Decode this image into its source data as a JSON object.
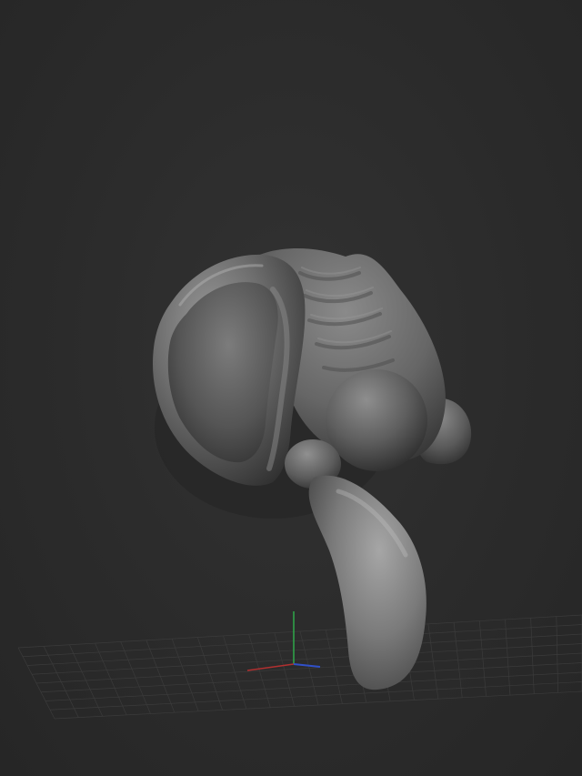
{
  "viewport": {
    "background": "#2b2b2b",
    "floor_grid_visible": true,
    "axis_gizmo": {
      "x_axis_color": "#b03030",
      "y_axis_color": "#2fa84a",
      "z_axis_color": "#3050c8"
    },
    "model": {
      "material_color": "#7a7a7a",
      "parts": [
        "ear-shell",
        "ridge-lobe",
        "side-bulb",
        "sphere",
        "neck-ball",
        "tail-blob"
      ]
    }
  }
}
